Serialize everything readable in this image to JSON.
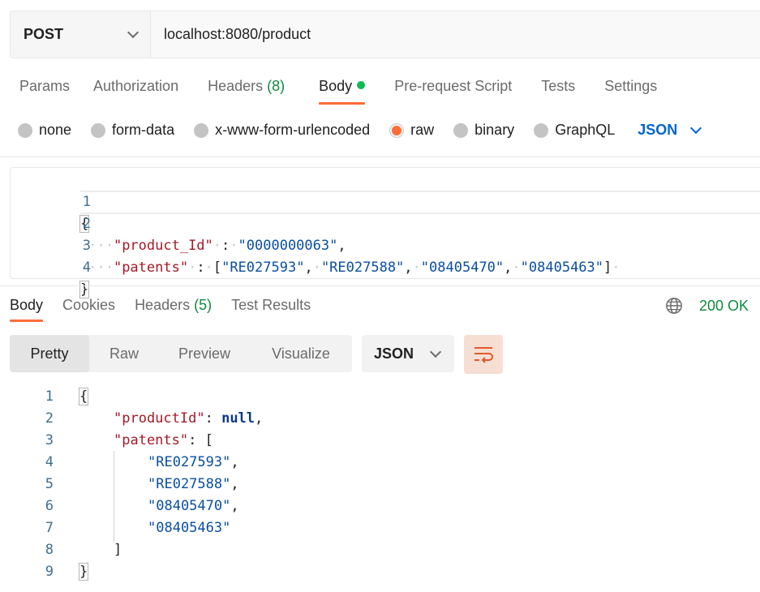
{
  "request": {
    "method": "POST",
    "url": "localhost:8080/product",
    "tabs": [
      {
        "label": "Params"
      },
      {
        "label": "Authorization"
      },
      {
        "label": "Headers",
        "count": "(8)"
      },
      {
        "label": "Body"
      },
      {
        "label": "Pre-request Script"
      },
      {
        "label": "Tests"
      },
      {
        "label": "Settings"
      }
    ],
    "body_types": [
      "none",
      "form-data",
      "x-www-form-urlencoded",
      "raw",
      "binary",
      "GraphQL"
    ],
    "selected_body_type": "raw",
    "language": "JSON",
    "body_lines": {
      "l1": "1",
      "l2": "2",
      "l3": "3",
      "l4": "4",
      "open": "{",
      "key1": "\"product_Id\"",
      "val1": "\"0000000063\"",
      "key2": "\"patents\"",
      "p1": "\"RE027593\"",
      "p2": "\"RE027588\"",
      "p3": "\"08405470\"",
      "p4": "\"08405463\"",
      "close": "}"
    }
  },
  "response": {
    "tabs": [
      {
        "label": "Body"
      },
      {
        "label": "Cookies"
      },
      {
        "label": "Headers",
        "count": "(5)"
      },
      {
        "label": "Test Results"
      }
    ],
    "status": "200 OK",
    "views": [
      "Pretty",
      "Raw",
      "Preview",
      "Visualize"
    ],
    "format": "JSON",
    "body_lines": {
      "n1": "1",
      "n2": "2",
      "n3": "3",
      "n4": "4",
      "n5": "5",
      "n6": "6",
      "n7": "7",
      "n8": "8",
      "n9": "9",
      "open": "{",
      "key1": "\"productId\"",
      "val1": "null",
      "key2": "\"patents\"",
      "p1": "\"RE027593\"",
      "p2": "\"RE027588\"",
      "p3": "\"08405470\"",
      "p4": "\"08405463\"",
      "close_arr": "]",
      "close": "}"
    }
  },
  "colors": {
    "accent": "#ff6c37",
    "success": "#0e8a3e",
    "link": "#0265d2"
  }
}
